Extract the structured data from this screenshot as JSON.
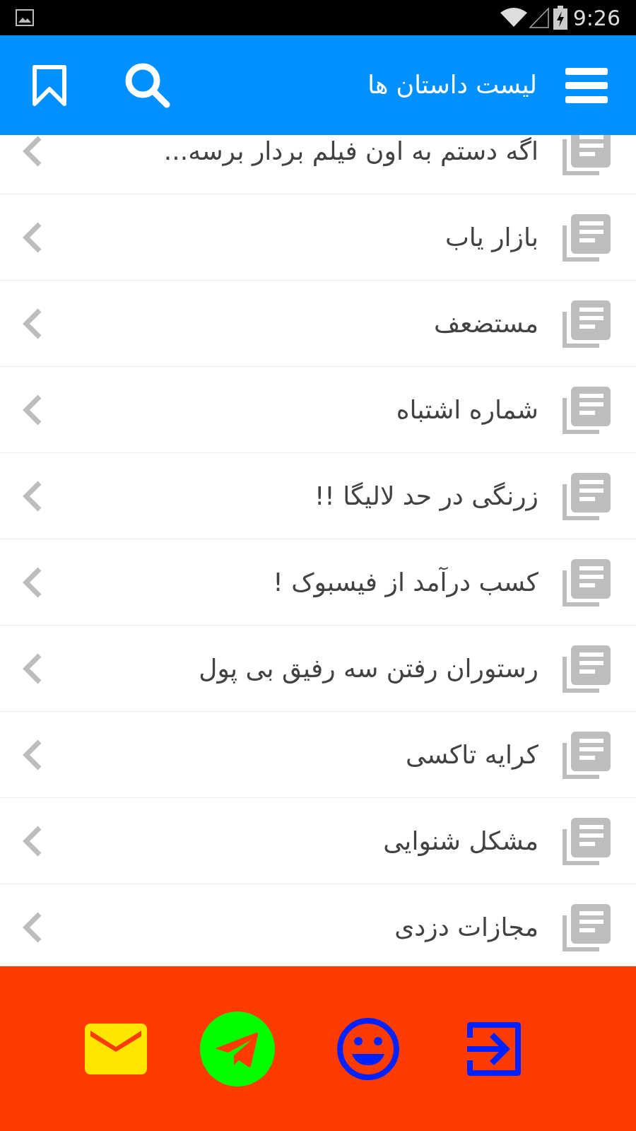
{
  "status_bar": {
    "time": "9:26"
  },
  "app_bar": {
    "title": "لیست داستان ها"
  },
  "stories": [
    {
      "title": "اگه دستم به اون فیلم بردار برسه..."
    },
    {
      "title": "بازار یاب"
    },
    {
      "title": "مستضعف"
    },
    {
      "title": "شماره اشتباه"
    },
    {
      "title": "زرنگی در حد لالیگا !!"
    },
    {
      "title": "کسب درآمد از فیسبوک !"
    },
    {
      "title": "رستوران رفتن سه رفیق بی پول"
    },
    {
      "title": "کرایه تاکسی"
    },
    {
      "title": "مشکل شنوایی"
    },
    {
      "title": "مجازات دزدی"
    }
  ],
  "bottom_bar": {
    "buttons": [
      {
        "kind": "mail"
      },
      {
        "kind": "telegram"
      },
      {
        "kind": "smiley"
      },
      {
        "kind": "login"
      }
    ]
  }
}
